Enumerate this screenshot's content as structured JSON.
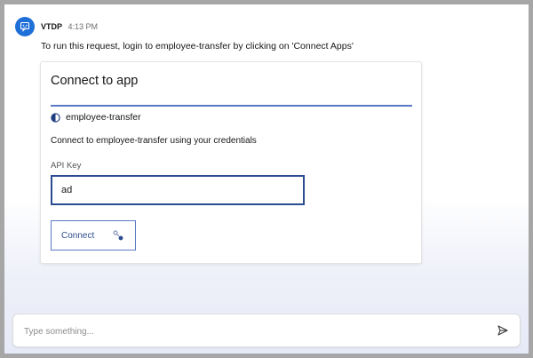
{
  "message": {
    "sender": "VTDP",
    "time": "4:13 PM",
    "text": "To run this request, login to employee-transfer by clicking on 'Connect Apps'"
  },
  "card": {
    "title": "Connect to app",
    "app_name": "employee-transfer",
    "description": "Connect to employee-transfer using your credentials",
    "api_key_label": "API Key",
    "api_key_value": "ad",
    "connect_label": "Connect"
  },
  "composer": {
    "placeholder": "Type something..."
  },
  "icons": {
    "avatar": "chat-bot-icon",
    "app": "half-circle-icon",
    "connect": "connecting-icon",
    "send": "send-icon"
  },
  "colors": {
    "accent": "#1f6fd9",
    "primary_dark": "#2b4c91",
    "divider": "#5a78c4"
  }
}
